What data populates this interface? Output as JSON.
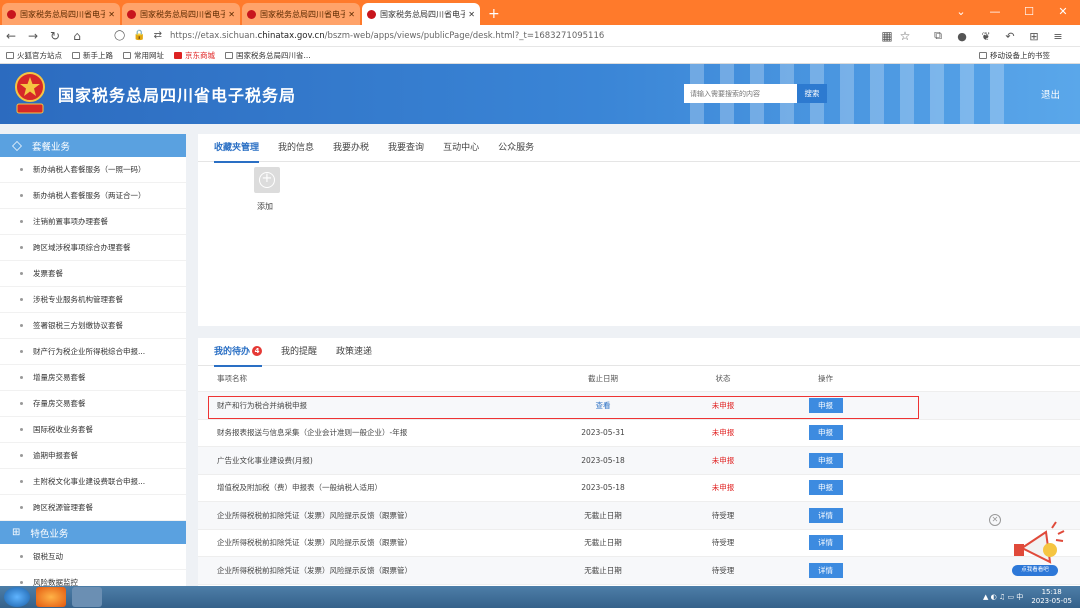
{
  "browser": {
    "tabs": [
      {
        "title": "国家税务总局四川省电子税务局",
        "active": false
      },
      {
        "title": "国家税务总局四川省电子税务局",
        "active": false
      },
      {
        "title": "国家税务总局四川省电子税务局",
        "active": false
      },
      {
        "title": "国家税务总局四川省电子税务局",
        "active": true
      }
    ],
    "url_prefix": "https://etax.sichuan.",
    "url_domain": "chinatax.gov.cn",
    "url_path": "/bszm-web/apps/views/publicPage/desk.html?_t=1683271095116",
    "bookmarks": [
      "火狐官方站点",
      "新手上路",
      "常用网址",
      "京东商城",
      "国家税务总局四川省..."
    ],
    "bookmarks_right": "移动设备上的书签"
  },
  "header": {
    "site_title": "国家税务总局四川省电子税务局",
    "search_placeholder": "请输入需要搜索的内容",
    "search_label": "搜索",
    "logout_label": "退出",
    "accent": "#3a85d6"
  },
  "sidebar": {
    "section1_title": "套餐业务",
    "items": [
      "新办纳税人套餐服务（一照一码）",
      "新办纳税人套餐服务（两证合一）",
      "注销前置事项办理套餐",
      "跨区域涉税事项综合办理套餐",
      "发票套餐",
      "涉税专业服务机构管理套餐",
      "签署银税三方划缴协议套餐",
      "财产行为税企业所得税综合申报...",
      "增量房交易套餐",
      "存量房交易套餐",
      "国际税收业务套餐",
      "逾期申报套餐",
      "主附税文化事业建设费联合申报...",
      "跨区税源管理套餐"
    ],
    "section2_title": "特色业务",
    "items2": [
      "银税互动",
      "风险数据监控"
    ]
  },
  "favorites_panel": {
    "tabs": [
      "收藏夹管理",
      "我的信息",
      "我要办税",
      "我要查询",
      "互动中心",
      "公众服务"
    ],
    "add_label": "添加"
  },
  "todo_panel": {
    "tabs": [
      "我的待办",
      "我的提醒",
      "政策速递"
    ],
    "todo_count": "4",
    "columns": [
      "事项名称",
      "截止日期",
      "状态",
      "操作"
    ],
    "rows": [
      {
        "name": "财产和行为税合并纳税申报",
        "deadline": "查看",
        "status": "未申报",
        "action": "申报"
      },
      {
        "name": "财务报表报送与信息采集（企业会计准则一般企业）-年报",
        "deadline": "2023-05-31",
        "status": "未申报",
        "action": "申报"
      },
      {
        "name": "广告业文化事业建设费(月报)",
        "deadline": "2023-05-18",
        "status": "未申报",
        "action": "申报"
      },
      {
        "name": "增值税及附加税（费）申报表（一般纳税人适用）",
        "deadline": "2023-05-18",
        "status": "未申报",
        "action": "申报"
      },
      {
        "name": "企业所得税税前扣除凭证（发票）风险提示反馈（跟票管）",
        "deadline": "无截止日期",
        "status": "待受理",
        "action": "详情"
      },
      {
        "name": "企业所得税税前扣除凭证（发票）风险提示反馈（跟票管）",
        "deadline": "无截止日期",
        "status": "待受理",
        "action": "详情"
      },
      {
        "name": "企业所得税税前扣除凭证（发票）风险提示反馈（跟票管）",
        "deadline": "无截止日期",
        "status": "待受理",
        "action": "详情"
      }
    ]
  },
  "promo": {
    "label": "点我看看吧"
  },
  "taskbar": {
    "time": "15:18",
    "date": "2023-05-05"
  }
}
